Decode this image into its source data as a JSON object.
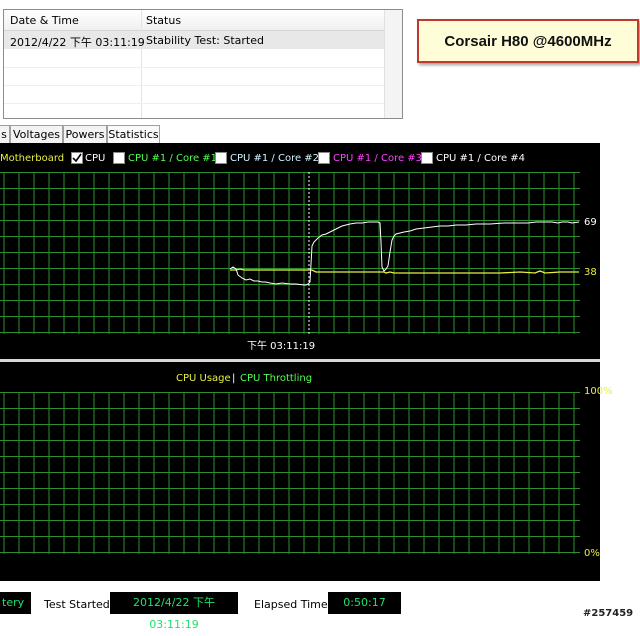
{
  "log": {
    "columns": [
      "Date & Time",
      "Status"
    ],
    "rows": [
      {
        "datetime": "2012/4/22 下午 03:11:19",
        "status": "Stability Test: Started"
      }
    ]
  },
  "title_box": "Corsair H80 @4600MHz",
  "tabs": [
    {
      "label": "s"
    },
    {
      "label": "Voltages"
    },
    {
      "label": "Powers"
    },
    {
      "label": "Statistics"
    }
  ],
  "temperature_graph": {
    "legend": [
      {
        "label": "Motherboard",
        "color": "#e8f040",
        "checkbox": false,
        "checked": false
      },
      {
        "label": "CPU",
        "color": "#ffffff",
        "checkbox": true,
        "checked": true
      },
      {
        "label": "CPU #1 / Core #1",
        "color": "#50ff50",
        "checkbox": true,
        "checked": false
      },
      {
        "label": "CPU #1 / Core #2",
        "color": "#d0f4ff",
        "checkbox": true,
        "checked": false
      },
      {
        "label": "CPU #1 / Core #3",
        "color": "#ff40ff",
        "checkbox": true,
        "checked": false
      },
      {
        "label": "CPU #1 / Core #4",
        "color": "#ffffff",
        "checkbox": true,
        "checked": false
      }
    ],
    "cpu_value": "69",
    "motherboard_value": "38",
    "time_marker": "下午 03:11:19"
  },
  "usage_graph": {
    "legend_usage": "CPU Usage",
    "legend_sep": "|",
    "legend_throttling": "CPU Throttling",
    "top_label": "100%",
    "bottom_label": "0%"
  },
  "footer": {
    "battery_label": "tery",
    "test_started_label": "Test Started:",
    "test_started_value": "2012/4/22 下午 03:11:19",
    "elapsed_label": "Elapsed Time:",
    "elapsed_value": "0:50:17"
  },
  "watermark": "#257459",
  "colors": {
    "grid": "#2e8f2e",
    "cpu_line": "#ffffff",
    "motherboard_line": "#e8f040",
    "footer_text": "#22e06b",
    "title_border": "#c03a2b"
  }
}
